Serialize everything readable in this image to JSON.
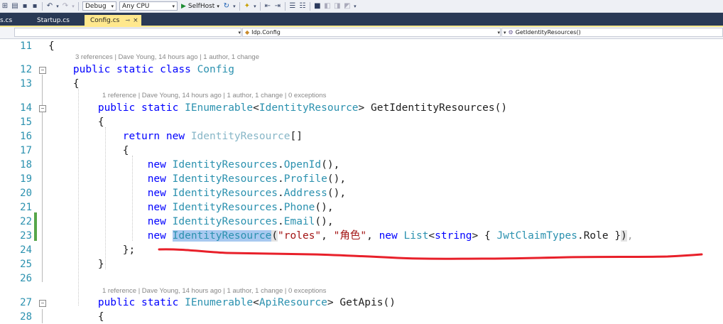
{
  "toolbar": {
    "config_value": "Debug",
    "platform_value": "Any CPU",
    "run_label": "SelfHost"
  },
  "tabs": [
    {
      "label": "s.cs"
    },
    {
      "label": "Startup.cs"
    },
    {
      "label": "Config.cs",
      "pin": "⊸",
      "close": "×"
    }
  ],
  "navbar": {
    "namespace_value": "Idp.Config",
    "member_value": "GetIdentityResources()"
  },
  "editor": {
    "line_numbers": [
      "11",
      "12",
      "13",
      "14",
      "15",
      "16",
      "17",
      "18",
      "19",
      "20",
      "21",
      "22",
      "23",
      "24",
      "25",
      "26",
      "27",
      "28"
    ],
    "codelens": {
      "class": "3 references | Dave Young, 14 hours ago | 1 author, 1 change",
      "method1": "1 reference | Dave Young, 14 hours ago | 1 author, 1 change | 0 exceptions",
      "method2": "1 reference | Dave Young, 14 hours ago | 1 author, 1 change | 0 exceptions"
    },
    "tokens": {
      "open_brace": "{",
      "close_brace": "}",
      "close_brace_semi": "};",
      "public": "public",
      "static": "static",
      "class": "class",
      "config_name": "Config",
      "ienumerable": "IEnumerable",
      "identity_resource": "IdentityResource",
      "api_resource": "ApiResource",
      "get_identity_resources": "GetIdentityResources()",
      "get_apis": "GetApis()",
      "return": "return",
      "new": "new",
      "array_brackets": "[]",
      "identity_resources_cls": "IdentityResources",
      "open_id": "OpenId",
      "profile": "Profile",
      "address": "Address",
      "phone": "Phone",
      "email": "Email",
      "call_suffix": "(),",
      "dot": ".",
      "str_roles": "\"roles\"",
      "str_role_cn": "\"角色\"",
      "list_type": "List",
      "string_type": "string",
      "jwt_claim_types": "JwtClaimTypes",
      "role": "Role"
    }
  },
  "colors": {
    "keyword": "#0000ff",
    "type": "#2b91af",
    "string": "#a31515",
    "line_number": "#2b91af",
    "annotation_red": "#e8202a",
    "change_marker": "#57a64a"
  }
}
